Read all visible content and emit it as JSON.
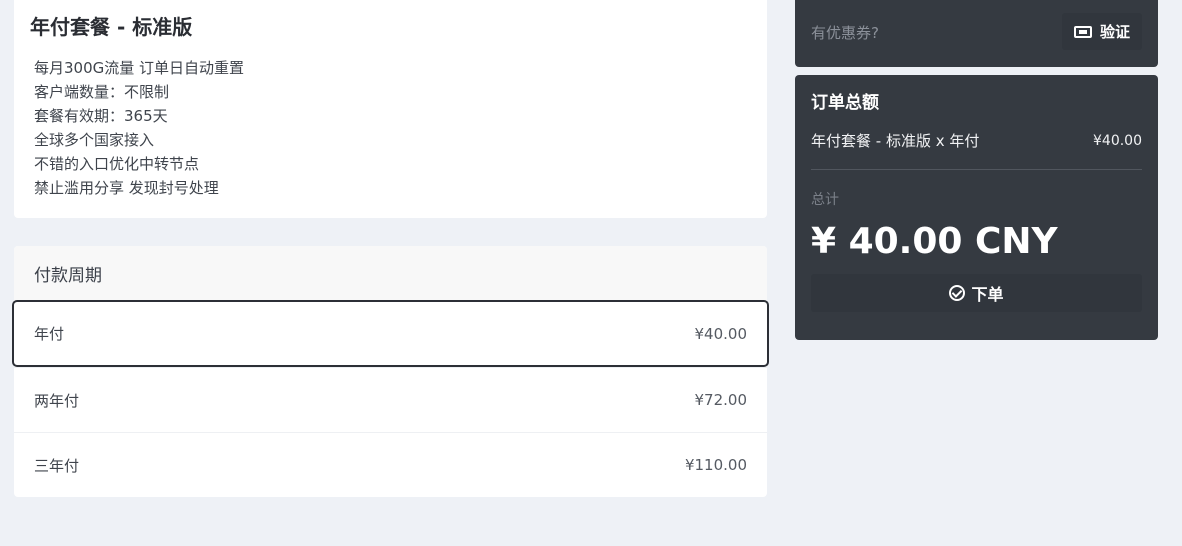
{
  "plan": {
    "title": "年付套餐 - 标准版",
    "features": [
      "每月300G流量 订单日自动重置",
      "客户端数量：不限制",
      "套餐有效期：365天",
      "全球多个国家接入",
      "不错的入口优化中转节点",
      "禁止滥用分享 发现封号处理"
    ]
  },
  "cycle": {
    "title": "付款周期",
    "options": [
      {
        "label": "年付",
        "price": "¥40.00",
        "selected": true
      },
      {
        "label": "两年付",
        "price": "¥72.00",
        "selected": false
      },
      {
        "label": "三年付",
        "price": "¥110.00",
        "selected": false
      }
    ]
  },
  "coupon": {
    "placeholder": "有优惠券?",
    "verify_label": "验证",
    "icon": "ticket-icon"
  },
  "order": {
    "title": "订单总额",
    "item_label": "年付套餐 - 标准版 x 年付",
    "item_amount": "¥40.00",
    "total_label": "总计",
    "total_amount": "¥ 40.00 CNY",
    "submit_label": "下单",
    "submit_icon": "check-circle-icon"
  },
  "colors": {
    "page_bg": "#eef1f6",
    "dark_card": "#353a41",
    "selected_border": "#2c2f36"
  }
}
